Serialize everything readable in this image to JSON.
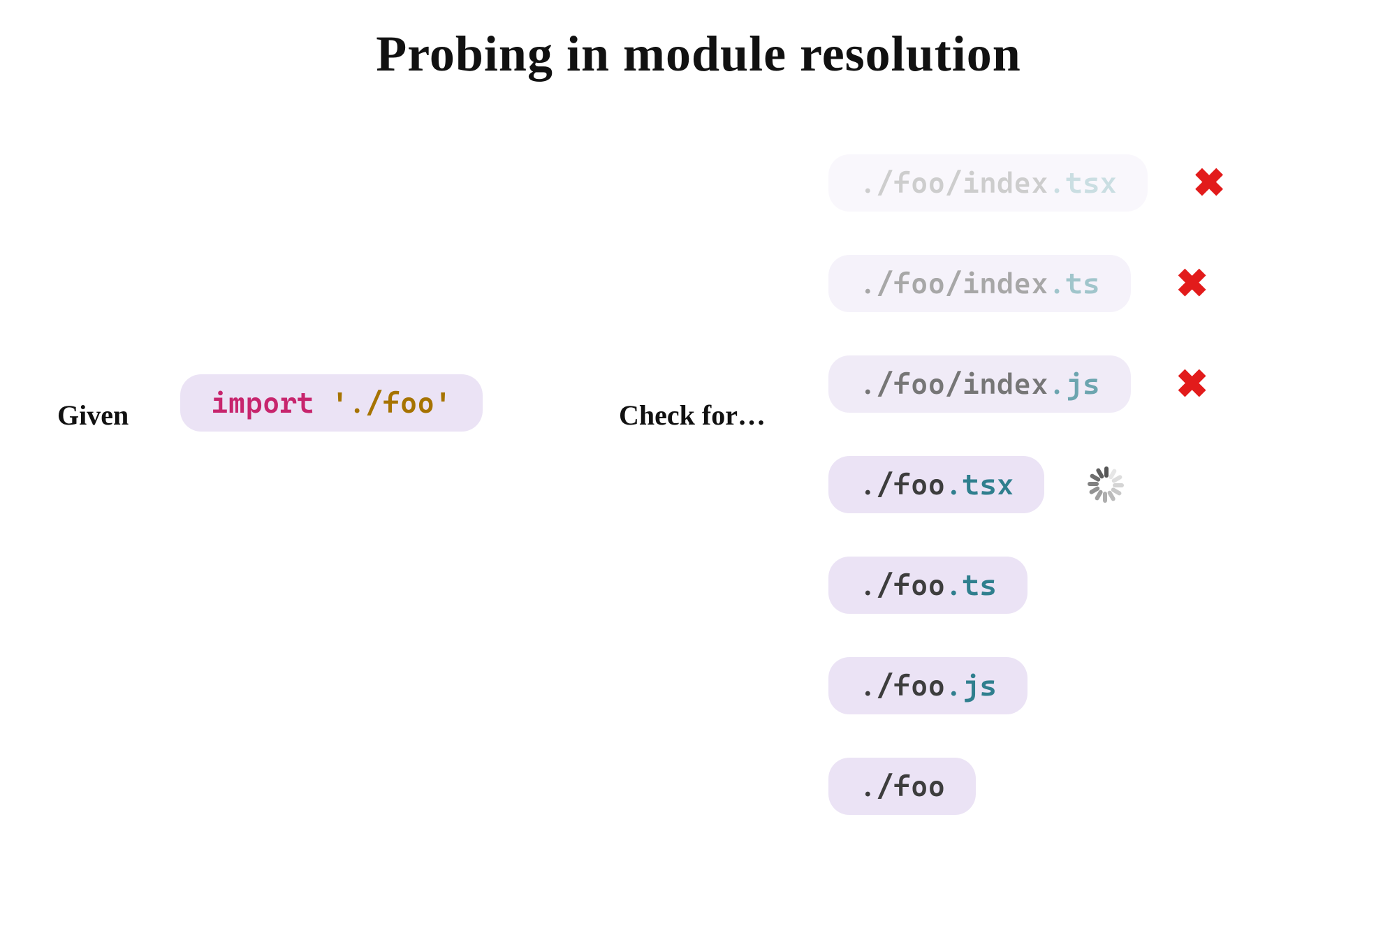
{
  "title": "Probing in module resolution",
  "labels": {
    "given": "Given",
    "check_for": "Check for…"
  },
  "source": {
    "keyword": "import",
    "argument": "'./foo'"
  },
  "probes": [
    {
      "path": "./foo/index",
      "ext": ".tsx",
      "status": "fail",
      "fade": 1
    },
    {
      "path": "./foo/index",
      "ext": ".ts",
      "status": "fail",
      "fade": 2
    },
    {
      "path": "./foo/index",
      "ext": ".js",
      "status": "fail",
      "fade": 3
    },
    {
      "path": "./foo",
      "ext": ".tsx",
      "status": "loading",
      "fade": 0
    },
    {
      "path": "./foo",
      "ext": ".ts",
      "status": "none",
      "fade": 0
    },
    {
      "path": "./foo",
      "ext": ".js",
      "status": "none",
      "fade": 0
    },
    {
      "path": "./foo",
      "ext": "",
      "status": "none",
      "fade": 0
    }
  ]
}
